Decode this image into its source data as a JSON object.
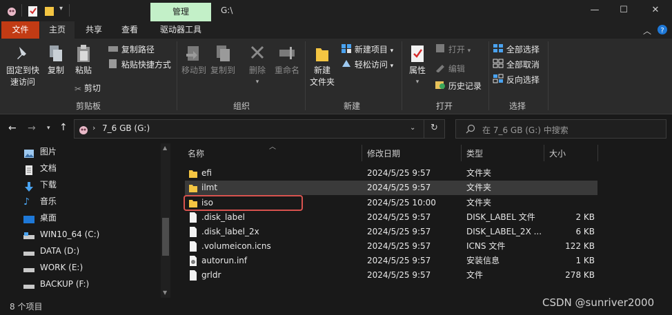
{
  "titlebar": {
    "manage_tab": "管理",
    "title": "G:\\",
    "minimize": "—",
    "maximize": "☐",
    "close": "✕"
  },
  "tabs": {
    "file": "文件",
    "home": "主页",
    "share": "共享",
    "view": "查看",
    "drive_tools": "驱动器工具"
  },
  "ribbon": {
    "pin_line1": "固定到快",
    "pin_line2": "速访问",
    "copy": "复制",
    "paste": "粘贴",
    "copy_path": "复制路径",
    "paste_shortcut": "粘贴快捷方式",
    "cut": "剪切",
    "clipboard_group": "剪贴板",
    "move_to": "移动到",
    "copy_to": "复制到",
    "delete": "删除",
    "rename": "重命名",
    "organize_group": "组织",
    "new_folder_line1": "新建",
    "new_folder_line2": "文件夹",
    "new_item": "新建项目",
    "easy_access": "轻松访问",
    "new_group": "新建",
    "properties": "属性",
    "open": "打开",
    "edit": "编辑",
    "history": "历史记录",
    "open_group": "打开",
    "select_all": "全部选择",
    "select_none": "全部取消",
    "invert_selection": "反向选择",
    "select_group": "选择"
  },
  "address": {
    "path": "7_6 GB (G:)",
    "search_placeholder": "在 7_6 GB (G:) 中搜索"
  },
  "nav": {
    "items": [
      {
        "label": "图片",
        "icon": "pictures-icon"
      },
      {
        "label": "文档",
        "icon": "documents-icon"
      },
      {
        "label": "下载",
        "icon": "downloads-icon"
      },
      {
        "label": "音乐",
        "icon": "music-icon"
      },
      {
        "label": "桌面",
        "icon": "desktop-icon"
      },
      {
        "label": "WIN10_64 (C:)",
        "icon": "drive-icon"
      },
      {
        "label": "DATA (D:)",
        "icon": "drive-icon"
      },
      {
        "label": "WORK (E:)",
        "icon": "drive-icon"
      },
      {
        "label": "BACKUP (F:)",
        "icon": "drive-icon"
      }
    ]
  },
  "columns": {
    "name": "名称",
    "date": "修改日期",
    "type": "类型",
    "size": "大小"
  },
  "files": [
    {
      "name": "efi",
      "date": "2024/5/25 9:57",
      "type": "文件夹",
      "size": "",
      "icon": "folder"
    },
    {
      "name": "ilmt",
      "date": "2024/5/25 9:57",
      "type": "文件夹",
      "size": "",
      "icon": "folder"
    },
    {
      "name": "iso",
      "date": "2024/5/25 10:00",
      "type": "文件夹",
      "size": "",
      "icon": "folder"
    },
    {
      "name": ".disk_label",
      "date": "2024/5/25 9:57",
      "type": "DISK_LABEL 文件",
      "size": "2 KB",
      "icon": "file"
    },
    {
      "name": ".disk_label_2x",
      "date": "2024/5/25 9:57",
      "type": "DISK_LABEL_2X ...",
      "size": "6 KB",
      "icon": "file"
    },
    {
      "name": ".volumeicon.icns",
      "date": "2024/5/25 9:57",
      "type": "ICNS 文件",
      "size": "122 KB",
      "icon": "file"
    },
    {
      "name": "autorun.inf",
      "date": "2024/5/25 9:57",
      "type": "安装信息",
      "size": "1 KB",
      "icon": "settings-file"
    },
    {
      "name": "grldr",
      "date": "2024/5/25 9:57",
      "type": "文件",
      "size": "278 KB",
      "icon": "file"
    }
  ],
  "status": {
    "count": "8 个项目"
  },
  "watermark": "CSDN @sunriver2000",
  "colors": {
    "accent_file_tab": "#c23b14",
    "manage_tab": "#c3f0c8",
    "folder": "#f4c542",
    "highlight_box": "#d9534f"
  }
}
